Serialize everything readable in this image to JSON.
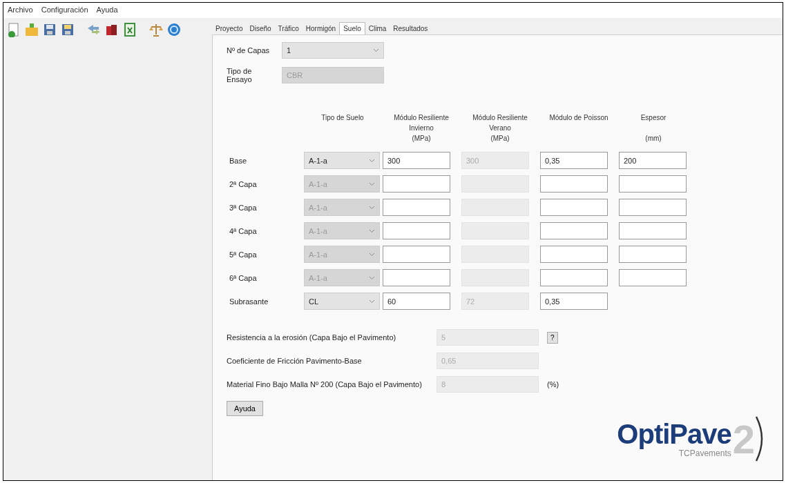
{
  "menu": [
    "Archivo",
    "Configuración",
    "Ayuda"
  ],
  "tabs": [
    {
      "label": "Proyecto",
      "selected": false
    },
    {
      "label": "Diseño",
      "selected": false
    },
    {
      "label": "Tráfico",
      "selected": false
    },
    {
      "label": "Hormigón",
      "selected": false
    },
    {
      "label": "Suelo",
      "selected": true
    },
    {
      "label": "Clima",
      "selected": false
    },
    {
      "label": "Resultados",
      "selected": false
    }
  ],
  "num_capas": {
    "label": "Nº de Capas",
    "value": "1"
  },
  "tipo_ensayo": {
    "label": "Tipo de Ensayo",
    "value": "CBR",
    "disabled": true
  },
  "columns": [
    {
      "title": "Tipo de Suelo"
    },
    {
      "title": "Módulo Resiliente",
      "subtitle": "Invierno",
      "unit": "(MPa)"
    },
    {
      "title": "Módulo Resiliente",
      "subtitle": "Verano",
      "unit": "(MPa)"
    },
    {
      "title": "Módulo de Poisson"
    },
    {
      "title": "Espesor",
      "unit": "(mm)"
    }
  ],
  "rows": [
    {
      "label": "Base",
      "soil": {
        "value": "A-1-a",
        "disabled": false
      },
      "cells": [
        {
          "value": "300",
          "disabled": false
        },
        {
          "value": "300",
          "disabled": true
        },
        {
          "value": "0,35",
          "disabled": false
        },
        {
          "value": "200",
          "disabled": false
        }
      ]
    },
    {
      "label": "2ª Capa",
      "soil": {
        "value": "A-1-a",
        "disabled": true
      },
      "cells": [
        {
          "disabled": false
        },
        {
          "disabled": true
        },
        {
          "disabled": false
        },
        {
          "disabled": false
        }
      ]
    },
    {
      "label": "3ª Capa",
      "soil": {
        "value": "A-1-a",
        "disabled": true
      },
      "cells": [
        {
          "disabled": false
        },
        {
          "disabled": true
        },
        {
          "disabled": false
        },
        {
          "disabled": false
        }
      ]
    },
    {
      "label": "4ª Capa",
      "soil": {
        "value": "A-1-a",
        "disabled": true
      },
      "cells": [
        {
          "disabled": false
        },
        {
          "disabled": true
        },
        {
          "disabled": false
        },
        {
          "disabled": false
        }
      ]
    },
    {
      "label": "5ª Capa",
      "soil": {
        "value": "A-1-a",
        "disabled": true
      },
      "cells": [
        {
          "disabled": false
        },
        {
          "disabled": true
        },
        {
          "disabled": false
        },
        {
          "disabled": false
        }
      ]
    },
    {
      "label": "6ª Capa",
      "soil": {
        "value": "A-1-a",
        "disabled": true
      },
      "cells": [
        {
          "disabled": false
        },
        {
          "disabled": true
        },
        {
          "disabled": false
        },
        {
          "disabled": false
        }
      ]
    },
    {
      "label": "Subrasante",
      "soil": {
        "value": "CL",
        "disabled": false
      },
      "cells": [
        {
          "value": "60",
          "disabled": false
        },
        {
          "value": "72",
          "disabled": true
        },
        {
          "value": "0,35",
          "disabled": false
        }
      ]
    }
  ],
  "params": [
    {
      "label": "Resistencia a la erosión (Capa Bajo el Pavimento)",
      "value": "5",
      "disabled": true,
      "help": "?"
    },
    {
      "label": "Coeficiente de Fricción Pavimento-Base",
      "value": "0,65",
      "disabled": true
    },
    {
      "label": "Material Fino Bajo Malla Nº 200 (Capa Bajo el Pavimento)",
      "value": "8",
      "disabled": true,
      "suffix": "(%)"
    }
  ],
  "help_button": "Ayuda",
  "logo": {
    "name": "OptiPave",
    "version": "2",
    "company": "TCPavements"
  }
}
